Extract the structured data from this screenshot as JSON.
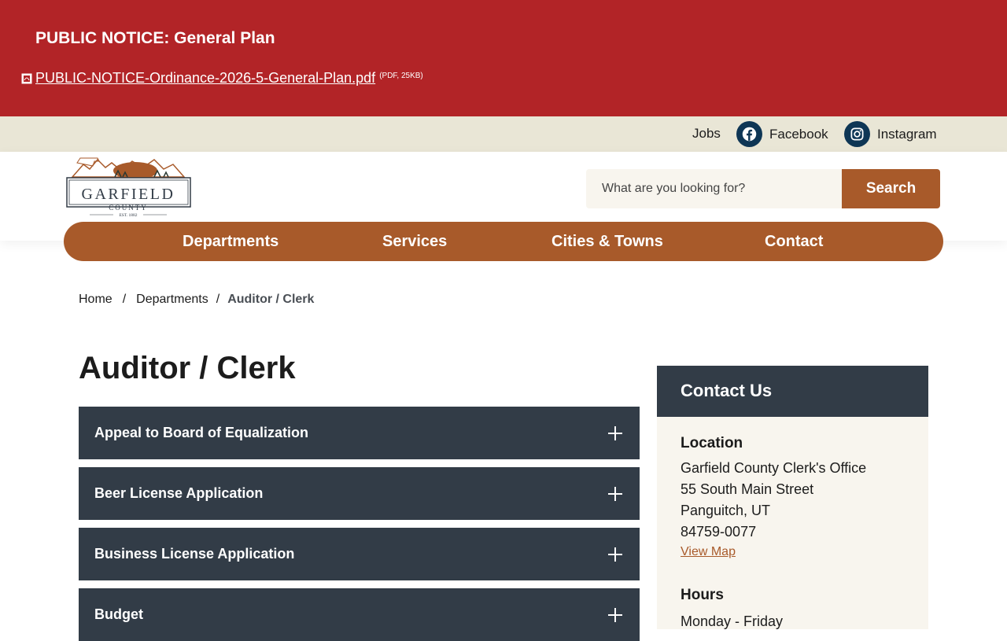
{
  "alert": {
    "title": "PUBLIC NOTICE: General Plan",
    "file_link": "PUBLIC-NOTICE-Ordinance-2026-5-General-Plan.pdf",
    "file_meta": "(PDF, 25KB)"
  },
  "utility": {
    "jobs": "Jobs",
    "facebook": "Facebook",
    "instagram": "Instagram"
  },
  "logo": {
    "name": "GARFIELD",
    "sub": "COUNTY",
    "est": "EST. 1882"
  },
  "search": {
    "placeholder": "What are you looking for?",
    "button": "Search"
  },
  "nav": {
    "items": [
      "Departments",
      "Services",
      "Cities & Towns",
      "Contact"
    ]
  },
  "breadcrumb": {
    "home": "Home",
    "departments": "Departments",
    "current": "Auditor / Clerk",
    "separator": "/"
  },
  "page": {
    "title": "Auditor / Clerk"
  },
  "accordion": [
    {
      "label": "Appeal to Board of Equalization"
    },
    {
      "label": "Beer License Application"
    },
    {
      "label": "Business License Application"
    },
    {
      "label": "Budget"
    }
  ],
  "sidebar": {
    "title": "Contact Us",
    "location_heading": "Location",
    "office": "Garfield County Clerk's Office",
    "street": "55 South Main Street",
    "city": "Panguitch, UT",
    "zip": "84759-0077",
    "map_link": "View Map",
    "hours_heading": "Hours",
    "hours_days": "Monday - Friday"
  },
  "colors": {
    "alert_bg": "#b22427",
    "utility_bg": "#e9e6d6",
    "brand_rust": "#a85a2a",
    "dark_slate": "#323c47",
    "social_navy": "#0e3655",
    "sidebar_bg": "#f8f5ee"
  }
}
